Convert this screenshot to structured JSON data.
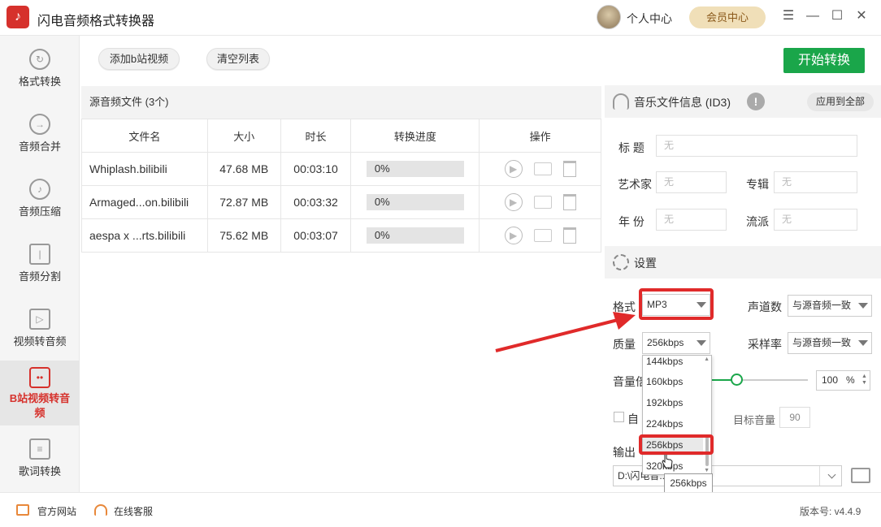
{
  "app": {
    "title": "闪电音频格式转换器",
    "personal_center": "个人中心",
    "vip_center": "会员中心",
    "window_controls": {
      "menu": "☰",
      "minimize": "—",
      "maximize": "☐",
      "close": "✕"
    }
  },
  "sidebar": {
    "items": [
      {
        "label": "格式转换",
        "icon": "refresh-icon"
      },
      {
        "label": "音频合并",
        "icon": "merge-icon"
      },
      {
        "label": "音频压缩",
        "icon": "compress-icon"
      },
      {
        "label": "音频分割",
        "icon": "split-icon"
      },
      {
        "label": "视频转音频",
        "icon": "video-icon"
      },
      {
        "label": "B站视频转音频",
        "icon": "bilibili-icon",
        "active": true
      },
      {
        "label": "歌词转换",
        "icon": "lyrics-icon"
      }
    ]
  },
  "toolbar": {
    "add_button": "添加b站视频",
    "clear_button": "清空列表",
    "start_button": "开始转换"
  },
  "files": {
    "header": "源音频文件 (3个)",
    "columns": [
      "文件名",
      "大小",
      "时长",
      "转换进度",
      "操作"
    ],
    "rows": [
      {
        "name": "Whiplash.bilibili",
        "size": "47.68 MB",
        "duration": "00:03:10",
        "progress": "0%"
      },
      {
        "name": "Armaged...on.bilibili",
        "size": "72.87 MB",
        "duration": "00:03:32",
        "progress": "0%"
      },
      {
        "name": "aespa x ...rts.bilibili",
        "size": "75.62 MB",
        "duration": "00:03:07",
        "progress": "0%"
      }
    ]
  },
  "id3": {
    "title": "音乐文件信息 (ID3)",
    "warn": "!",
    "apply_all": "应用到全部",
    "fields": {
      "title_label": "标  题",
      "artist_label": "艺术家",
      "album_label": "专辑",
      "year_label": "年  份",
      "genre_label": "流派",
      "placeholder": "无"
    }
  },
  "settings": {
    "title": "设置",
    "format_label": "格式",
    "format_value": "MP3",
    "channels_label": "声道数",
    "channels_value": "与源音频一致",
    "quality_label": "质量",
    "quality_value": "256kbps",
    "samplerate_label": "采样率",
    "samplerate_value": "与源音频一致",
    "volume_label": "音量倍",
    "volume_value": "100",
    "volume_unit": "%",
    "volume_level_percent": 25,
    "auto_label": "自",
    "target_volume_label": "目标音量",
    "target_volume_value": "90",
    "output_label": "输出",
    "output_path": "D:\\闪电音... ...音\\"
  },
  "quality_dropdown": {
    "options": [
      "144kbps",
      "160kbps",
      "192kbps",
      "224kbps",
      "256kbps",
      "320kbps"
    ],
    "selected": "256kbps",
    "tooltip": "256kbps"
  },
  "footer": {
    "website": "官方网站",
    "support": "在线客服",
    "version": "版本号: v4.4.9"
  },
  "colors": {
    "accent": "#d6312c",
    "start_button": "#1aa64a",
    "highlight": "#e02a2a"
  }
}
